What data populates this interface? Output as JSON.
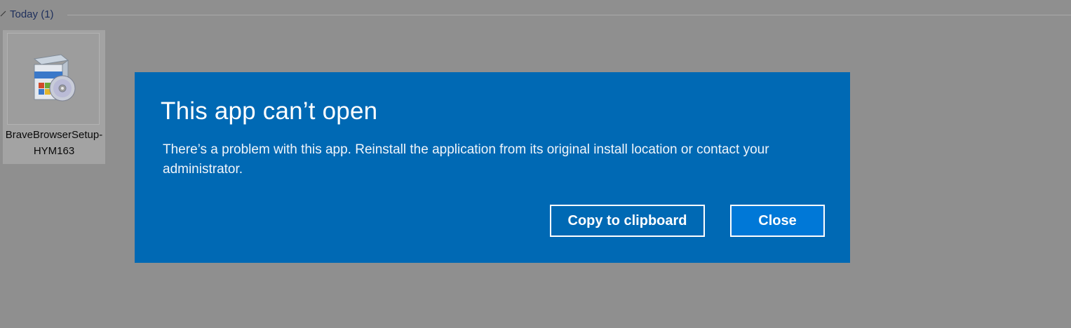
{
  "explorer": {
    "group": {
      "title": "Today (1)",
      "icon": "chevron-down-icon"
    },
    "file": {
      "name": "BraveBrowserSetup-HYM163",
      "icon": "installer-package-icon"
    }
  },
  "dialog": {
    "title": "This app can’t open",
    "message": "There’s a problem with this app. Reinstall the application from its original install location or contact your administrator.",
    "copy_button_label": "Copy to clipboard",
    "close_button_label": "Close",
    "colors": {
      "background": "#0069b4",
      "primary_button": "#0078d7",
      "text": "#ffffff"
    }
  }
}
